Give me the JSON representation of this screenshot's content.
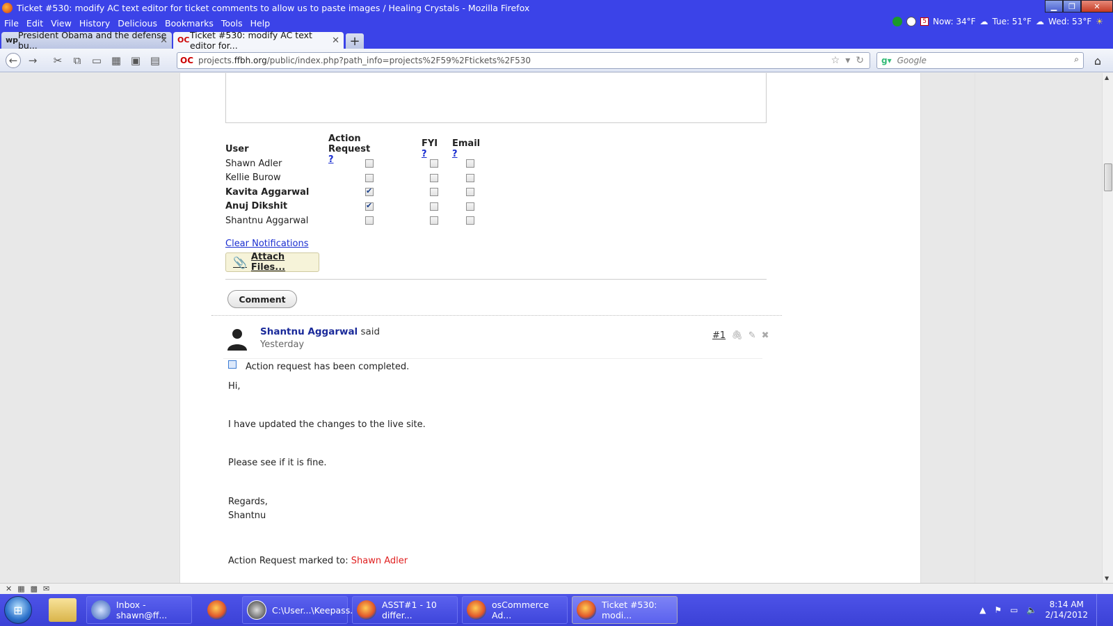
{
  "window": {
    "title": "Ticket #530: modify AC text editor for ticket comments to allow us to paste images / Healing Crystals - Mozilla Firefox"
  },
  "menu": {
    "items": [
      "File",
      "Edit",
      "View",
      "History",
      "Delicious",
      "Bookmarks",
      "Tools",
      "Help"
    ]
  },
  "weather": {
    "calendar_day": "5",
    "now": "Now: 34°F",
    "tue": "Tue: 51°F",
    "wed": "Wed: 53°F"
  },
  "tabs": [
    {
      "label": "President Obama and the defense bu...",
      "active": false
    },
    {
      "label": "Ticket #530: modify AC text editor for...",
      "active": true
    }
  ],
  "newtab_label": "+",
  "address": {
    "prefix": "projects.",
    "domain": "ffbh.org",
    "path": "/public/index.php?path_info=projects%2F59%2Ftickets%2F530",
    "site_badge": "OC"
  },
  "search": {
    "placeholder": "Google"
  },
  "notifications": {
    "headers": {
      "user": "User",
      "action_request": "Action Request",
      "fyi": "FYI",
      "email": "Email",
      "help": "?"
    },
    "rows": [
      {
        "name": "Shawn Adler",
        "bold": false,
        "action": false,
        "fyi": false,
        "email": false
      },
      {
        "name": "Kellie Burow",
        "bold": false,
        "action": false,
        "fyi": false,
        "email": false
      },
      {
        "name": "Kavita Aggarwal",
        "bold": true,
        "action": true,
        "fyi": false,
        "email": false
      },
      {
        "name": "Anuj Dikshit",
        "bold": true,
        "action": true,
        "fyi": false,
        "email": false
      },
      {
        "name": "Shantnu Aggarwal",
        "bold": false,
        "action": false,
        "fyi": false,
        "email": false
      }
    ],
    "clear_label": "Clear Notifications",
    "attach_label": "Attach Files...",
    "comment_button": "Comment"
  },
  "comment": {
    "author": "Shantnu Aggarwal",
    "said": "said",
    "when": "Yesterday",
    "number": "#1",
    "action_status": "Action request has been completed.",
    "lines": [
      "Hi,",
      "I have updated the changes to the live site.",
      "Please see if it is fine.",
      "Regards,",
      "Shantnu"
    ],
    "action_marked_label": "Action Request marked to:",
    "action_marked_user": "Shawn Adler"
  },
  "taskbar": {
    "items": [
      {
        "label": "Inbox - shawn@ff...",
        "active": false
      },
      {
        "label": "",
        "active": false
      },
      {
        "label": "C:\\User...\\Keepass...",
        "active": false
      },
      {
        "label": "ASST#1 - 10 differ...",
        "active": false
      },
      {
        "label": "osCommerce Ad...",
        "active": false
      },
      {
        "label": "Ticket #530: modi...",
        "active": true
      }
    ],
    "time": "8:14 AM",
    "date": "2/14/2012"
  }
}
